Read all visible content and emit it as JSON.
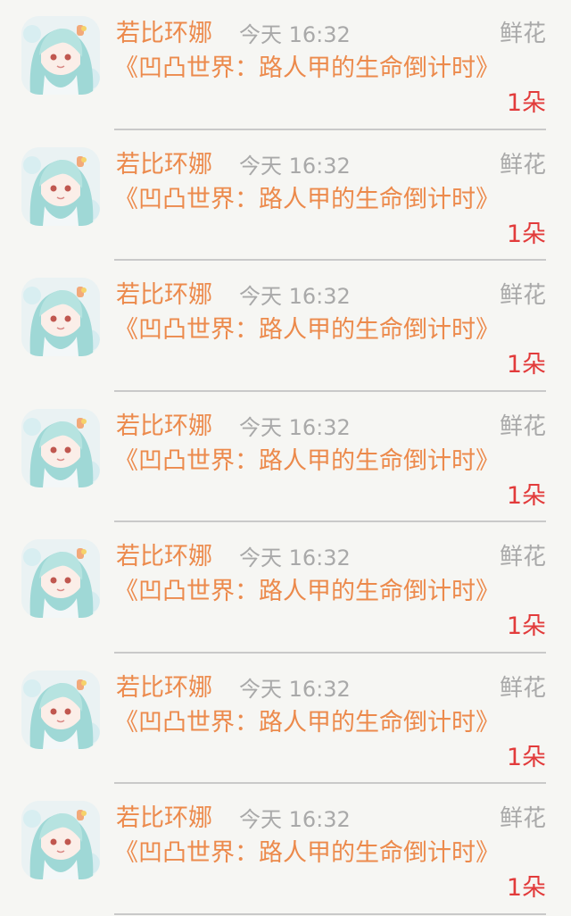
{
  "list": {
    "items": [
      {
        "name": "若比环娜",
        "time": "今天 16:32",
        "gift_type": "鲜花",
        "title": "《凹凸世界：路人甲的生命倒计时》",
        "count": "1朵"
      },
      {
        "name": "若比环娜",
        "time": "今天 16:32",
        "gift_type": "鲜花",
        "title": "《凹凸世界：路人甲的生命倒计时》",
        "count": "1朵"
      },
      {
        "name": "若比环娜",
        "time": "今天 16:32",
        "gift_type": "鲜花",
        "title": "《凹凸世界：路人甲的生命倒计时》",
        "count": "1朵"
      },
      {
        "name": "若比环娜",
        "time": "今天 16:32",
        "gift_type": "鲜花",
        "title": "《凹凸世界：路人甲的生命倒计时》",
        "count": "1朵"
      },
      {
        "name": "若比环娜",
        "time": "今天 16:32",
        "gift_type": "鲜花",
        "title": "《凹凸世界：路人甲的生命倒计时》",
        "count": "1朵"
      },
      {
        "name": "若比环娜",
        "time": "今天 16:32",
        "gift_type": "鲜花",
        "title": "《凹凸世界：路人甲的生命倒计时》",
        "count": "1朵"
      },
      {
        "name": "若比环娜",
        "time": "今天 16:32",
        "gift_type": "鲜花",
        "title": "《凹凸世界：路人甲的生命倒计时》",
        "count": "1朵"
      }
    ]
  },
  "colors": {
    "name": "#ec8a4c",
    "meta": "#a9a9a9",
    "count": "#e23b3b",
    "divider": "#c9c9c9",
    "background": "#f6f6f3"
  },
  "icons": {
    "avatar": "anime-girl-avatar-icon"
  }
}
